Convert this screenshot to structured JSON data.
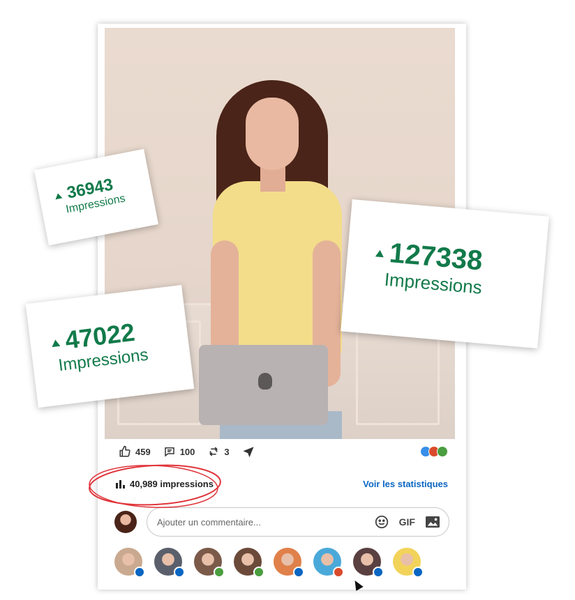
{
  "stats_cards": [
    {
      "value": "36943",
      "label": "Impressions"
    },
    {
      "value": "127338",
      "label": "Impressions"
    },
    {
      "value": "47022",
      "label": "Impressions"
    }
  ],
  "post": {
    "reactions": {
      "likes": "459",
      "comments": "100",
      "reposts": "3"
    },
    "impressions_text": "40,989 impressions",
    "stats_link": "Voir les statistiques",
    "comment_placeholder": "Ajouter un commentaire...",
    "gif_label": "GIF"
  },
  "colors": {
    "accent_green": "#127a4a",
    "link_blue": "#0a66c2",
    "annotation_red": "#e0343a"
  },
  "reaction_icons": [
    "like-icon",
    "celebrate-icon",
    "support-icon"
  ],
  "commenter_avatars": [
    {
      "badge": "like-badge",
      "badge_color": "#0a66c2"
    },
    {
      "badge": "like-badge",
      "badge_color": "#0a66c2"
    },
    {
      "badge": "insightful-badge",
      "badge_color": "#4a9e3f"
    },
    {
      "badge": "insightful-badge",
      "badge_color": "#4a9e3f"
    },
    {
      "badge": "like-badge",
      "badge_color": "#0a66c2"
    },
    {
      "badge": "love-badge",
      "badge_color": "#d94a2b"
    },
    {
      "badge": "like-badge",
      "badge_color": "#0a66c2"
    },
    {
      "badge": "like-badge",
      "badge_color": "#0a66c2"
    }
  ]
}
